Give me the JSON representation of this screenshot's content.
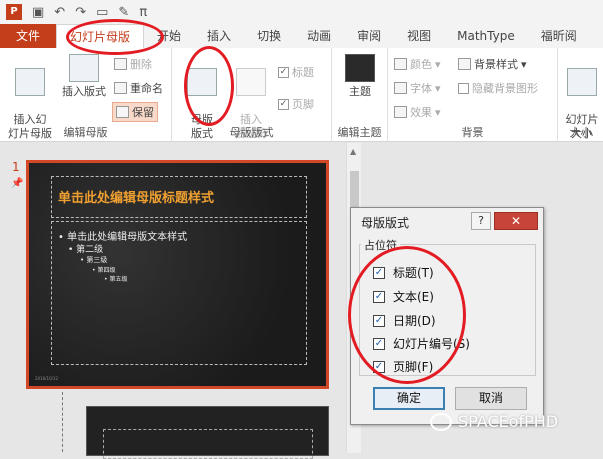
{
  "qat": {
    "undo": "↶",
    "redo": "↷",
    "pi": "π"
  },
  "tabs": [
    "文件",
    "幻灯片母版",
    "开始",
    "插入",
    "切换",
    "动画",
    "审阅",
    "视图",
    "MathType",
    "福昕阅"
  ],
  "ribbon": {
    "group1": {
      "insert_master": "插入幻\n灯片母版",
      "insert_layout": "插入版式",
      "delete": "删除",
      "rename": "重命名",
      "preserve": "保留",
      "label": "编辑母版"
    },
    "group2": {
      "master_layout": "母版\n版式",
      "insert_placeholder": "插入\n占位符",
      "title_chk": "标题",
      "footer_chk": "页脚",
      "label": "母版版式"
    },
    "group3": {
      "theme": "主题",
      "label": "编辑主题"
    },
    "group4": {
      "colors": "颜色",
      "fonts": "字体",
      "effects": "效果",
      "bg_styles": "背景样式",
      "hide_bg": "隐藏背景图形",
      "label": "背景"
    },
    "group5": {
      "slide_size": "幻灯片\n大小",
      "label": "大小"
    }
  },
  "thumbnail": {
    "number": "1",
    "title": "单击此处编辑母版标题样式",
    "levels": [
      "• 单击此处编辑母版文本样式",
      "• 第二级",
      "• 第三级",
      "• 第四级",
      "• 第五级"
    ],
    "footer": "2016/10/12"
  },
  "dialog": {
    "title": "母版版式",
    "help": "?",
    "close": "✕",
    "group": "占位符",
    "items": [
      "标题(T)",
      "文本(E)",
      "日期(D)",
      "幻灯片编号(S)",
      "页脚(F)"
    ],
    "ok": "确定",
    "cancel": "取消"
  },
  "watermark": "SPACEofPHD",
  "colors": {
    "accent": "#c43e1c",
    "highlight": "#e31b23"
  }
}
